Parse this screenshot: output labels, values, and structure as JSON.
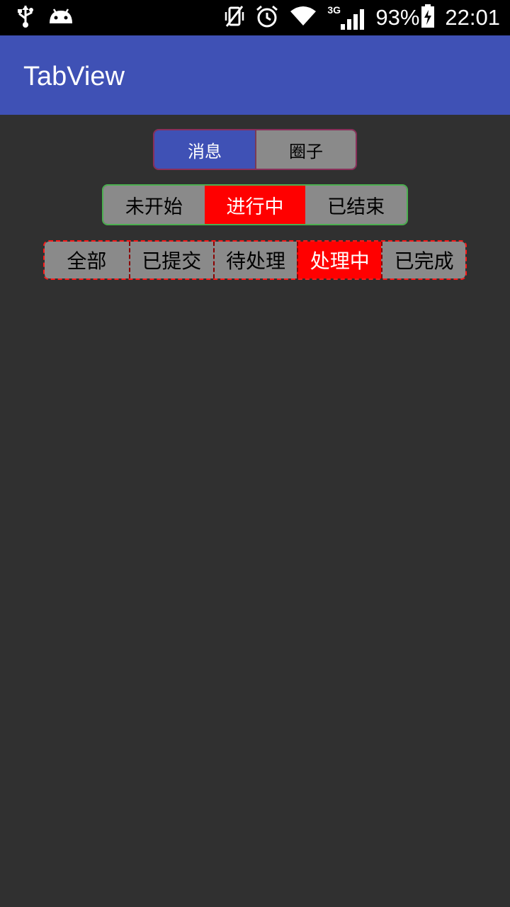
{
  "status_bar": {
    "icons_left": [
      "usb-icon",
      "android-icon"
    ],
    "icons_right": [
      "vibrate-off-icon",
      "alarm-icon",
      "wifi-icon",
      "signal-3g-icon",
      "battery-charging-icon"
    ],
    "network": "3G",
    "battery": "93%",
    "time": "22:01"
  },
  "app_bar": {
    "title": "TabView",
    "color": "#3F51B5"
  },
  "tab_groups": [
    {
      "tabs": [
        "消息",
        "圈子"
      ],
      "selected": 0,
      "selected_color": "#3F51B5"
    },
    {
      "tabs": [
        "未开始",
        "进行中",
        "已结束"
      ],
      "selected": 1,
      "selected_color": "#FF0000"
    },
    {
      "tabs": [
        "全部",
        "已提交",
        "待处理",
        "处理中",
        "已完成"
      ],
      "selected": 3,
      "selected_color": "#FF0000"
    }
  ],
  "colors": {
    "background": "#303030",
    "tab_unselected": "#8A8A8A"
  }
}
